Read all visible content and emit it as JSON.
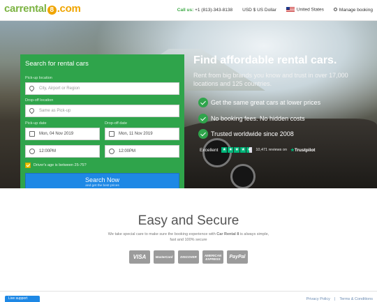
{
  "header": {
    "logo": {
      "part1": "car",
      "part2": "rental",
      "badge": "8",
      "part3": ".com"
    },
    "call_label": "Call us:",
    "phone": "+1 (813)-343-8138",
    "currency": "USD $ US Dollar",
    "country": "United States",
    "manage_booking": "Manage booking"
  },
  "search": {
    "title": "Search for rental cars",
    "pickup_location_label": "Pick-up location",
    "pickup_location_placeholder": "City, Airport or Region",
    "dropoff_location_label": "Drop-off location",
    "dropoff_location_placeholder": "Same as Pick-up",
    "pickup_date_label": "Pick-up date",
    "pickup_date": "Mon, 04 Nov 2019",
    "dropoff_date_label": "Drop-off date",
    "dropoff_date": "Mon, 11 Nov 2019",
    "pickup_time": "12:00PM",
    "dropoff_time": "12:00PM",
    "age_label": "Driver's age is between 25-75?",
    "age_checked": true,
    "button_label": "Search Now",
    "button_sub": "and get the best prices"
  },
  "hero": {
    "title": "Find affordable rental cars.",
    "subtitle": "Rent from big brands you know and trust in over 17,000 locations and 125 countries.",
    "features": [
      "Get the same great cars at lower prices",
      "No booking fees. No hidden costs",
      "Trusted worldwide since 2008"
    ],
    "rating_word": "Excellent",
    "stars": 4.5,
    "reviews": "10,471 reviews on",
    "trustpilot": "Trustpilot"
  },
  "secure": {
    "title": "Easy and Secure",
    "text_before": "We take special care to make sure the booking experience with ",
    "text_brand": "Car Rental 8",
    "text_after": " is always simple, fast and 100% secure",
    "cards": [
      "VISA",
      "MasterCard",
      "DISCOVER",
      "AMERICAN EXPRESS",
      "PayPal"
    ]
  },
  "footer": {
    "button": "Live support",
    "links": [
      "Privacy Policy",
      "Terms & Conditions"
    ]
  },
  "colors": {
    "brand_green": "#2fa44b",
    "brand_orange": "#f0a500",
    "button_blue": "#1e88e5"
  }
}
